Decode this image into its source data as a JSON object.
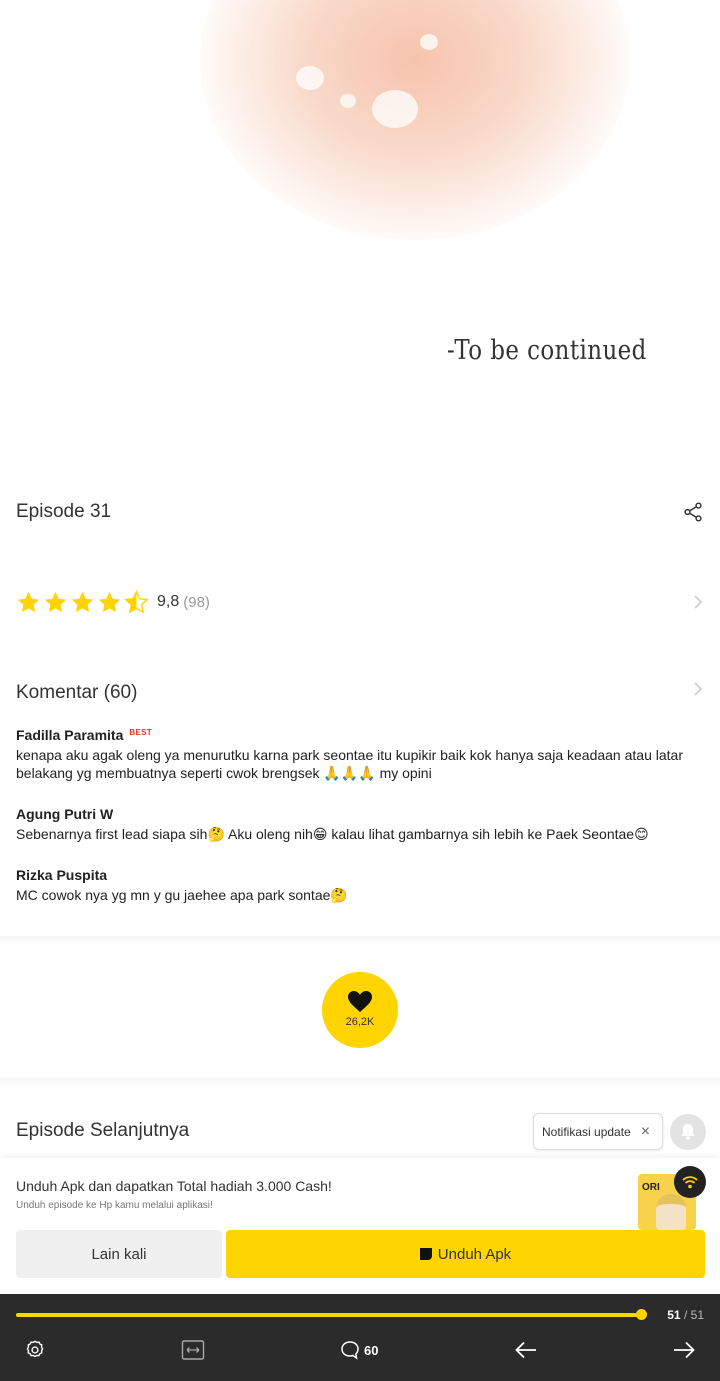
{
  "panel": {
    "text": "-To be continued"
  },
  "episode": {
    "title": "Episode 31"
  },
  "rating": {
    "value": "9,8",
    "count": "(98)",
    "stars": 4.5
  },
  "comments": {
    "title": "Komentar (60)",
    "items": [
      {
        "user": "Fadilla Paramita",
        "badge": "BEST",
        "text": "kenapa aku agak oleng ya menurutku karna park seontae itu kupikir baik kok hanya saja keadaan atau latar belakang yg membuatnya seperti cwok brengsek 🙏🙏🙏 my opini"
      },
      {
        "user": "Agung Putri W",
        "text": "Sebenarnya first lead siapa sih🤔 Aku oleng nih😁 kalau lihat gambarnya sih lebih ke Paek Seontae😊"
      },
      {
        "user": "Rizka Puspita",
        "text": "MC cowok nya yg mn y gu jaehee apa park sontae🤔"
      }
    ]
  },
  "like": {
    "count": "26,2K"
  },
  "next": {
    "title": "Episode Selanjutnya",
    "notif_label": "Notifikasi update",
    "notif_close": "×"
  },
  "download": {
    "title": "Unduh Apk dan dapatkan Total hadiah 3.000 Cash!",
    "subtitle": "Unduh episode ke Hp kamu melalui aplikasi!",
    "thumb_label": "ORI",
    "later_label": "Lain kali",
    "download_label": "Unduh Apk"
  },
  "bottom_bar": {
    "page_current": "51",
    "page_separator": "/",
    "page_total": "51",
    "progress": 1.0,
    "comment_count": "60"
  },
  "colors": {
    "accent": "#ffd400",
    "bar_bg": "#2b2b2b",
    "best_badge": "#e8342a"
  }
}
